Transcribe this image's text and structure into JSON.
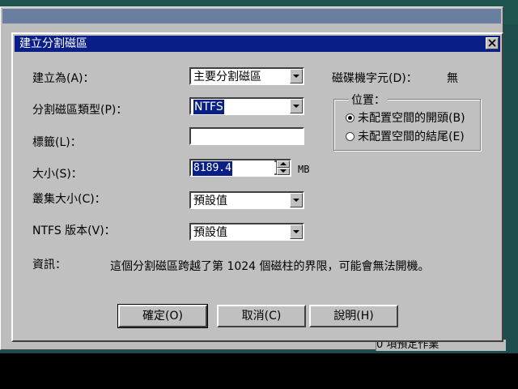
{
  "background": {
    "status_text": "0  項預定作業"
  },
  "dialog": {
    "title": "建立分割磁區",
    "create_as_label": "建立為(A)：",
    "create_as_value": "主要分割磁區",
    "drive_letter_label": "磁碟機字元(D)：",
    "drive_letter_value": "無",
    "partition_type_label": "分割磁區類型(P)：",
    "partition_type_value": "NTFS",
    "volume_label_label": "標籤(L)：",
    "volume_label_value": "",
    "size_label": "大小(S)：",
    "size_value": "8189.4",
    "size_unit": "MB",
    "cluster_size_label": "叢集大小(C)：",
    "cluster_size_value": "預設值",
    "ntfs_version_label": "NTFS 版本(V)：",
    "ntfs_version_value": "預設值",
    "position_group_title": "位置：",
    "position_options": [
      "未配置空間的開頭(B)",
      "未配置空間的結尾(E)"
    ],
    "position_selected_index": 0,
    "info_label": "資訊：",
    "info_text": "這個分割磁區跨越了第 1024 個磁柱的界限，可能會無法開機。",
    "ok_label": "確定(O)",
    "cancel_label": "取消(C)",
    "help_label": "說明(H)"
  },
  "colors": {
    "title_bar": "#0a1e87",
    "dialog_face": "#c0c0c0",
    "selection": "#0a1e87"
  }
}
